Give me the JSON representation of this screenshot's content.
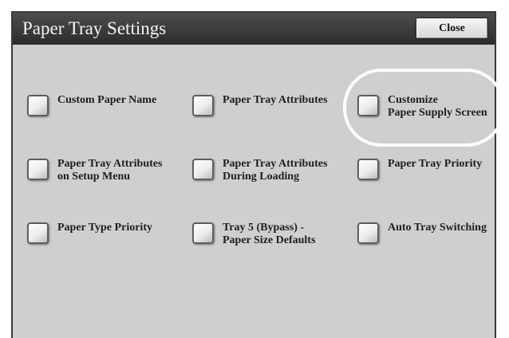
{
  "header": {
    "title": "Paper Tray Settings",
    "close_label": "Close"
  },
  "options": [
    {
      "label": "Custom Paper Name",
      "checked": false
    },
    {
      "label": "Paper Tray Attributes",
      "checked": false
    },
    {
      "label": "Customize\nPaper Supply Screen",
      "checked": false
    },
    {
      "label": "Paper Tray Attributes\non Setup Menu",
      "checked": false
    },
    {
      "label": "Paper Tray Attributes\nDuring Loading",
      "checked": false
    },
    {
      "label": "Paper Tray Priority",
      "checked": false
    },
    {
      "label": "Paper Type Priority",
      "checked": false
    },
    {
      "label": "Tray 5 (Bypass) -\nPaper Size Defaults",
      "checked": false
    },
    {
      "label": "Auto Tray Switching",
      "checked": false
    }
  ],
  "colors": {
    "titlebar": "#3a3a3a",
    "panel": "#cfcfcf",
    "highlight": "#ffffff"
  }
}
